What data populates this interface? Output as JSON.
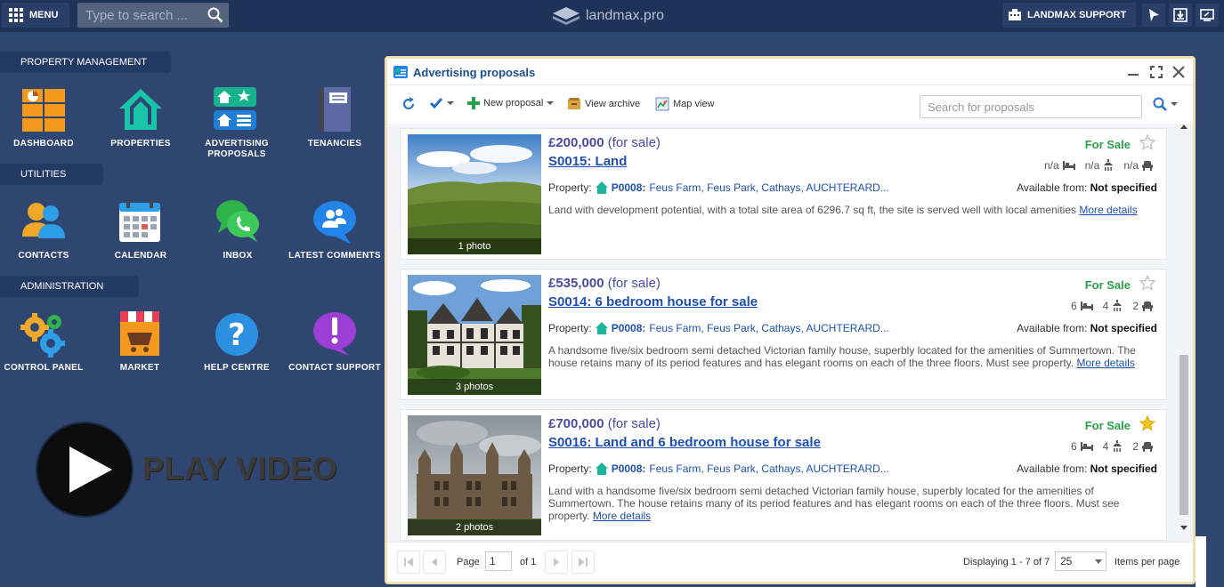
{
  "topbar": {
    "menu_label": "MENU",
    "search_placeholder": "Type to search ...",
    "logo_text": "landmax.pro",
    "support_label": "LANDMAX SUPPORT"
  },
  "nav": {
    "sections": [
      {
        "title": "PROPERTY MANAGEMENT",
        "items": [
          "DASHBOARD",
          "PROPERTIES",
          "ADVERTISING PROPOSALS",
          "TENANCIES"
        ]
      },
      {
        "title": "UTILITIES",
        "items": [
          "CONTACTS",
          "CALENDAR",
          "INBOX",
          "LATEST COMMENTS"
        ]
      },
      {
        "title": "ADMINISTRATION",
        "items": [
          "CONTROL PANEL",
          "MARKET",
          "HELP CENTRE",
          "CONTACT SUPPORT"
        ]
      }
    ],
    "play_video": "PLAY VIDEO"
  },
  "window": {
    "title": "Advertising proposals",
    "toolbar": {
      "new_proposal": "New proposal",
      "view_archive": "View archive",
      "map_view": "Map view",
      "search_placeholder": "Search for proposals"
    },
    "proposals": [
      {
        "price": "£200,000",
        "price_note": "(for sale)",
        "title": "S0015:  Land",
        "status": "For Sale",
        "starred": false,
        "beds": "n/a",
        "baths": "n/a",
        "receptions": "n/a",
        "property_label": "Property:",
        "property_code": "P0008:",
        "address": "Feus Farm, Feus Park, Cathays, AUCHTERARD...",
        "available_label": "Available from:",
        "available_value": "Not specified",
        "description": "Land with development potential, with a total site area of 6296.7 sq ft, the site is served well with local amenities",
        "more": "More details",
        "photos": "1 photo"
      },
      {
        "price": "£535,000",
        "price_note": "(for sale)",
        "title": "S0014:  6 bedroom house for sale",
        "status": "For Sale",
        "starred": false,
        "beds": "6",
        "baths": "4",
        "receptions": "2",
        "property_label": "Property:",
        "property_code": "P0008:",
        "address": "Feus Farm, Feus Park, Cathays, AUCHTERARD...",
        "available_label": "Available from:",
        "available_value": "Not specified",
        "description": "A handsome five/six bedroom semi detached Victorian family house, superbly located for the amenities of Summertown. The house retains many of its period features and has elegant rooms on each of the three floors. Must see property.",
        "more": "More details",
        "photos": "3 photos"
      },
      {
        "price": "£700,000",
        "price_note": "(for sale)",
        "title": "S0016:  Land and 6 bedroom house for sale",
        "status": "For Sale",
        "starred": true,
        "beds": "6",
        "baths": "4",
        "receptions": "2",
        "property_label": "Property:",
        "property_code": "P0008:",
        "address": "Feus Farm, Feus Park, Cathays, AUCHTERARD...",
        "available_label": "Available from:",
        "available_value": "Not specified",
        "description": "Land with a handsome five/six bedroom semi detached Victorian family house, superbly located for the amenities of Summertown. The house retains many of its period features and has elegant rooms on each of the three floors. Must see property.",
        "more": "More details",
        "photos": "2 photos"
      }
    ],
    "pager": {
      "page_label": "Page",
      "page_value": "1",
      "of_label": "of 1",
      "displaying": "Displaying 1 - 7 of 7",
      "per_page_value": "25",
      "per_page_label": "Items per page"
    }
  },
  "colors": {
    "background": "#2f4671",
    "topbar": "#1f3359",
    "accent_blue": "#1f4fb0",
    "status_green": "#2aa04a",
    "window_border": "#f0dfb0"
  }
}
